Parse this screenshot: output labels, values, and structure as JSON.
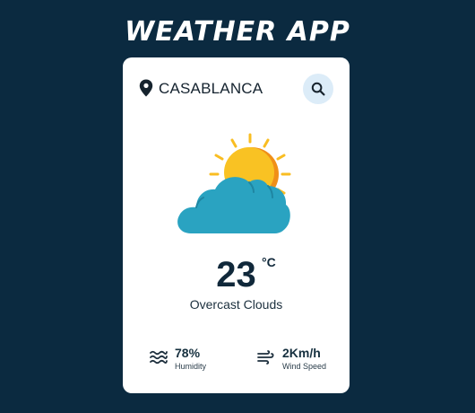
{
  "app": {
    "title": "WEATHER APP"
  },
  "search": {
    "city": "CASABLANCA",
    "search_icon": "search-icon",
    "location_icon": "location-pin-icon"
  },
  "weather": {
    "icon": "partly-cloudy-icon",
    "temperature": "23",
    "unit": "°C",
    "description": "Overcast Clouds"
  },
  "stats": {
    "humidity": {
      "value": "78%",
      "label": "Humidity",
      "icon": "humidity-waves-icon"
    },
    "wind": {
      "value": "2Km/h",
      "label": "Wind Speed",
      "icon": "wind-icon"
    }
  },
  "colors": {
    "background": "#0b2a40",
    "card": "#ffffff",
    "search_button": "#dcecf8",
    "sun": "#f9b820",
    "cloud": "#2aa3c1"
  }
}
